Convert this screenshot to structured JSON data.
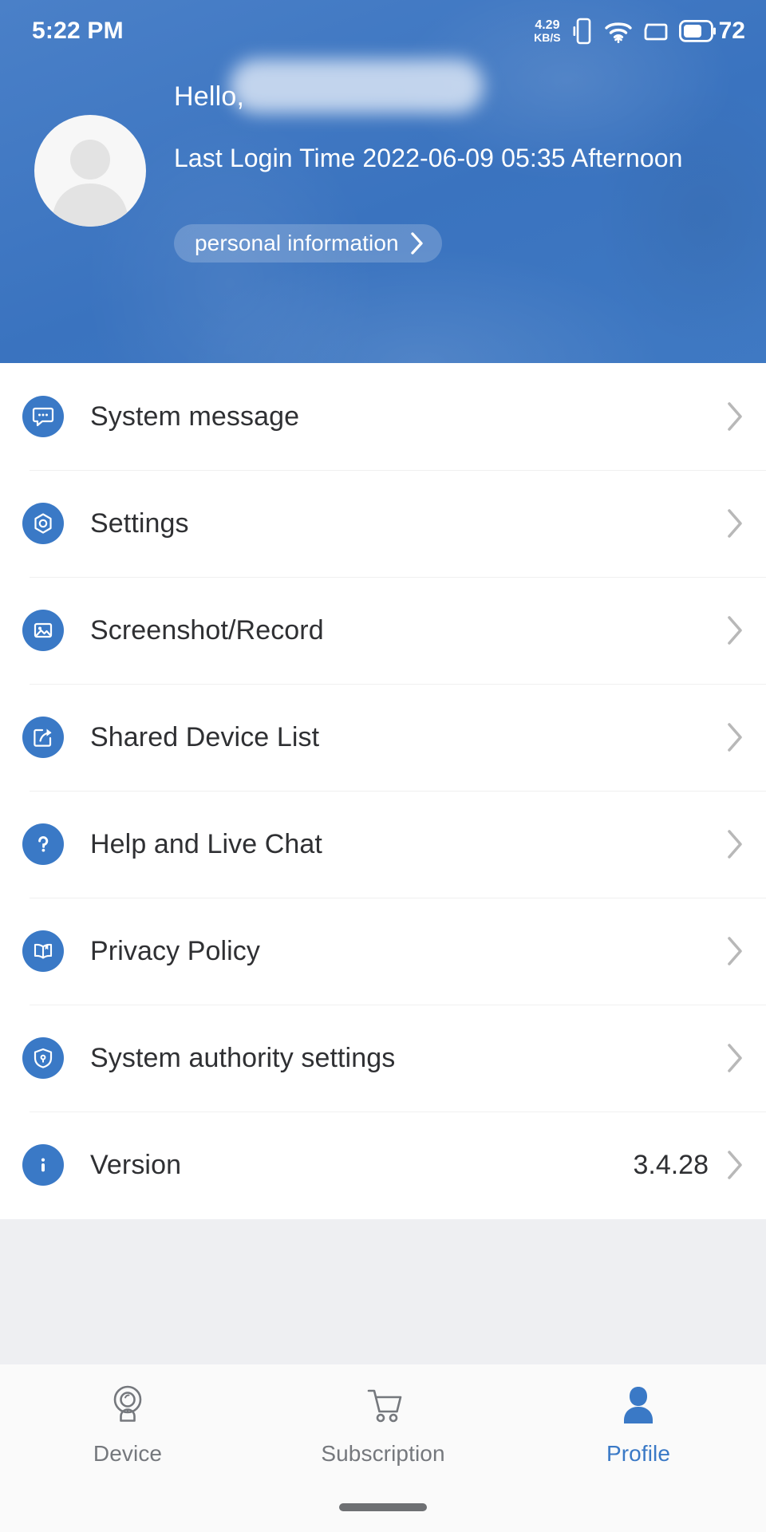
{
  "status_bar": {
    "time": "5:22 PM",
    "network_speed_value": "4.29",
    "network_speed_unit": "KB/S",
    "battery_level": "72",
    "icons": [
      "vibrate-icon",
      "wifi-icon",
      "sim-icon",
      "battery-icon"
    ]
  },
  "header": {
    "greeting": "Hello,",
    "username_redacted": "",
    "last_login": "Last Login Time 2022-06-09 05:35 Afternoon",
    "personal_information_label": "personal information",
    "background_color": "#3c78c4",
    "avatar_icon": "default-avatar-person"
  },
  "menu": {
    "items": [
      {
        "label": "System message",
        "icon": "message-bubble-icon",
        "value": ""
      },
      {
        "label": "Settings",
        "icon": "gear-icon",
        "value": ""
      },
      {
        "label": "Screenshot/Record",
        "icon": "image-icon",
        "value": ""
      },
      {
        "label": "Shared Device List",
        "icon": "share-export-icon",
        "value": ""
      },
      {
        "label": "Help and Live Chat",
        "icon": "question-mark-icon",
        "value": ""
      },
      {
        "label": "Privacy Policy",
        "icon": "book-icon",
        "value": ""
      },
      {
        "label": "System authority settings",
        "icon": "shield-lock-icon",
        "value": ""
      },
      {
        "label": "Version",
        "icon": "info-icon",
        "value": "3.4.28"
      }
    ]
  },
  "bottom_nav": {
    "active_color": "#3a79c6",
    "inactive_color": "#75787d",
    "items": [
      {
        "label": "Device",
        "icon": "camera-icon",
        "active": false
      },
      {
        "label": "Subscription",
        "icon": "shopping-cart-icon",
        "active": false
      },
      {
        "label": "Profile",
        "icon": "person-icon",
        "active": true
      }
    ]
  }
}
